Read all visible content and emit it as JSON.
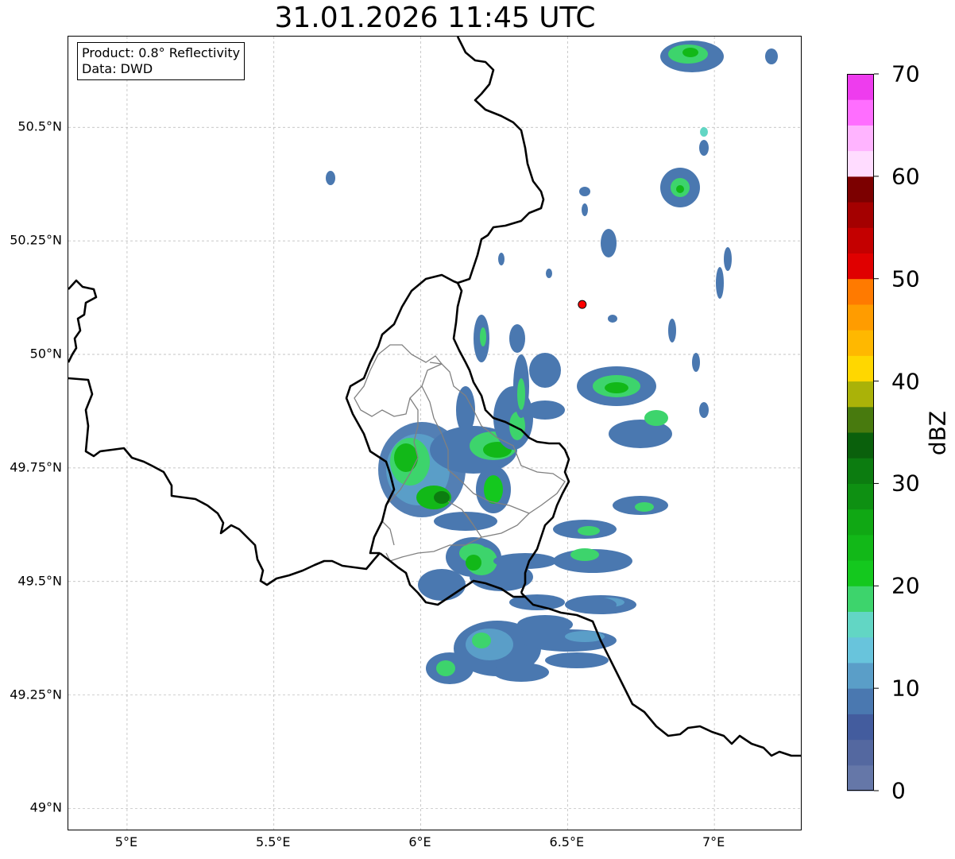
{
  "title": "31.01.2026 11:45 UTC",
  "info_box": {
    "product": "Product: 0.8° Reflectivity",
    "source": "Data: DWD"
  },
  "map": {
    "lon_range": [
      4.8,
      7.3
    ],
    "lat_range": [
      48.95,
      50.7
    ],
    "lon_ticks": [
      {
        "value": 5.0,
        "label": "5°E"
      },
      {
        "value": 5.5,
        "label": "5.5°E"
      },
      {
        "value": 6.0,
        "label": "6°E"
      },
      {
        "value": 6.5,
        "label": "6.5°E"
      },
      {
        "value": 7.0,
        "label": "7°E"
      }
    ],
    "lat_ticks": [
      {
        "value": 49.0,
        "label": "49°N"
      },
      {
        "value": 49.25,
        "label": "49.25°N"
      },
      {
        "value": 49.5,
        "label": "49.5°N"
      },
      {
        "value": 49.75,
        "label": "49.75°N"
      },
      {
        "value": 50.0,
        "label": "50°N"
      },
      {
        "value": 50.25,
        "label": "50.25°N"
      },
      {
        "value": 50.5,
        "label": "50.5°N"
      }
    ],
    "grid": true,
    "radar_site": {
      "lon": 6.55,
      "lat": 50.11,
      "color": "#ff0000"
    }
  },
  "colorbar": {
    "label": "dBZ",
    "min": 0,
    "max": 70,
    "ticks": [
      "0",
      "10",
      "20",
      "30",
      "40",
      "50",
      "60",
      "70"
    ],
    "colors": [
      "#6577a8",
      "#5468a0",
      "#435c9e",
      "#4a78b0",
      "#5a9ec8",
      "#68c4dc",
      "#62d6c4",
      "#3dd46c",
      "#14c81e",
      "#12b818",
      "#10a814",
      "#0e9012",
      "#0c7c10",
      "#0a600c",
      "#487a0e",
      "#aab208",
      "#ffd700",
      "#ffb800",
      "#ff9c00",
      "#ff7a00",
      "#e00000",
      "#c40000",
      "#a40000",
      "#7c0000",
      "#ffdcff",
      "#ffb4ff",
      "#ff6eff",
      "#ee3cee"
    ]
  },
  "legend_colors": {
    "border_country": "#000000",
    "border_canton": "#808080",
    "grid": "#b4b4b4"
  }
}
